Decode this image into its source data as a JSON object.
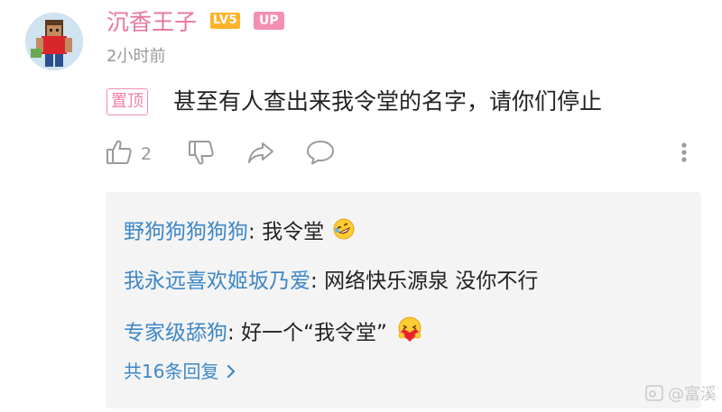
{
  "comment": {
    "username": "沉香王子",
    "level_badge": "LV5",
    "up_badge": "UP",
    "time": "2小时前",
    "pin_label": "置顶",
    "text": "甚至有人查出来我令堂的名字，请你们停止",
    "like_count": "2"
  },
  "replies": [
    {
      "name": "野狗狗狗狗狗",
      "sep": ": ",
      "text": "我令堂",
      "emoji": "rofl-emoji"
    },
    {
      "name": "我永远喜欢姬坂乃爱",
      "sep": ": ",
      "text": "网络快乐源泉 没你不行"
    },
    {
      "name": "专家级舔狗",
      "sep": ": ",
      "text": "好一个“我令堂”",
      "emoji": "heart-hug-emoji"
    }
  ],
  "more_replies": "共16条回复",
  "watermark": "@富溪"
}
